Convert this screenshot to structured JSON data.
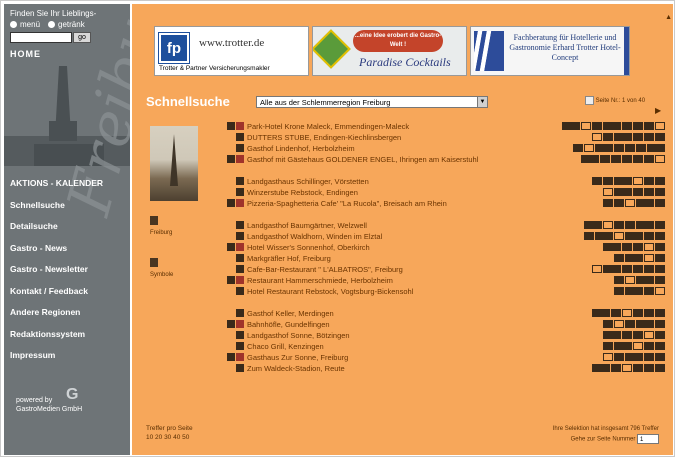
{
  "sidebar": {
    "find_label": "Finden Sie Ihr Lieblings-",
    "radio_menu": "menü",
    "radio_drinks": "getränk",
    "go_label": "go",
    "home_label": "HOME",
    "script_text": "Freiburg",
    "nav": [
      "AKTIONS - KALENDER",
      "Schnellsuche",
      "Detailsuche",
      "Gastro - News",
      "Gastro - Newsletter",
      "Kontakt / Feedback",
      "Andere Regionen",
      "Redaktionssystem",
      "Impressum"
    ],
    "powered_by": "powered by",
    "powered_company": "GastroMedien GmbH",
    "logo_glyph": "G"
  },
  "banners": {
    "b1_logo": "fp",
    "b1_url": "www.trotter.de",
    "b1_sub": "Trotter & Partner Versicherungsmakler",
    "b2_cloud": "...eine Idee erobert die Gastro-Welt !",
    "b2_title": "Paradise Cocktails",
    "b3_title": "Fachberatung für Hotellerie und Gastronomie Erhard Trotter Hotel-Concept"
  },
  "quicksearch": {
    "title": "Schnellsuche",
    "select_value": "Alle aus der Schlemmerregion Freiburg",
    "page_info": "Seite Nr.: 1 von 40",
    "next_arrow": "▶"
  },
  "side_links": {
    "city": "Freiburg",
    "region": "Symbole"
  },
  "results": [
    {
      "name": "Park-Hotel Krone Maleck, Emmendingen-Maleck",
      "tall": false
    },
    {
      "name": "DUTTERS STUBE, Endingen-Kiechlinsbergen",
      "tall": false
    },
    {
      "name": "Gasthof Lindenhof, Herbolzheim",
      "tall": false
    },
    {
      "name": "Gasthof mit Gästehaus GOLDENER ENGEL, Ihringen am Kaiserstuhl",
      "tall": true
    },
    {
      "name": "Landgasthaus Schillinger, Vörstetten",
      "tall": false
    },
    {
      "name": "Winzerstube Rebstock, Endingen",
      "tall": false
    },
    {
      "name": "Pizzeria-Spaghetteria Cafe' \"La Rucola\", Breisach am Rhein",
      "tall": true
    },
    {
      "name": "Landgasthof Baumgärtner, Welzwell",
      "tall": false
    },
    {
      "name": "Landgasthof Waldhorn, Winden im Elztal",
      "tall": false
    },
    {
      "name": "Hotel Wisser's Sonnenhof, Oberkirch",
      "tall": false
    },
    {
      "name": "Markgräfler Hof, Freiburg",
      "tall": false
    },
    {
      "name": "Cafe-Bar-Restaurant \" L'ALBATROS\", Freiburg",
      "tall": false
    },
    {
      "name": "Restaurant Hammerschmiede, Herbolzheim",
      "tall": false
    },
    {
      "name": "Hotel Restaurant Rebstock, Vogtsburg-Bickensohl",
      "tall": true
    },
    {
      "name": "Gasthof Keller, Merdingen",
      "tall": false
    },
    {
      "name": "Bahnhöfle, Gundelfingen",
      "tall": false
    },
    {
      "name": "Landgasthof Sonne, Bötzingen",
      "tall": false
    },
    {
      "name": "Chaco Grill, Kenzingen",
      "tall": false
    },
    {
      "name": "Gasthaus Zur Sonne, Freiburg",
      "tall": false
    },
    {
      "name": "Zum Waldeck-Stadion, Reute",
      "tall": false
    }
  ],
  "footer": {
    "per_page_label": "Treffer pro Seite",
    "per_page_options": "10 20 30 40 50",
    "found_text": "Ihre Selektion hat insgesamt 796 Treffer",
    "goto_label": "Gehe zur Seite Nummer",
    "goto_value": "1"
  },
  "colors": {
    "main_bg": "#f7a75a",
    "sidebar_bg": "#6e7477"
  }
}
